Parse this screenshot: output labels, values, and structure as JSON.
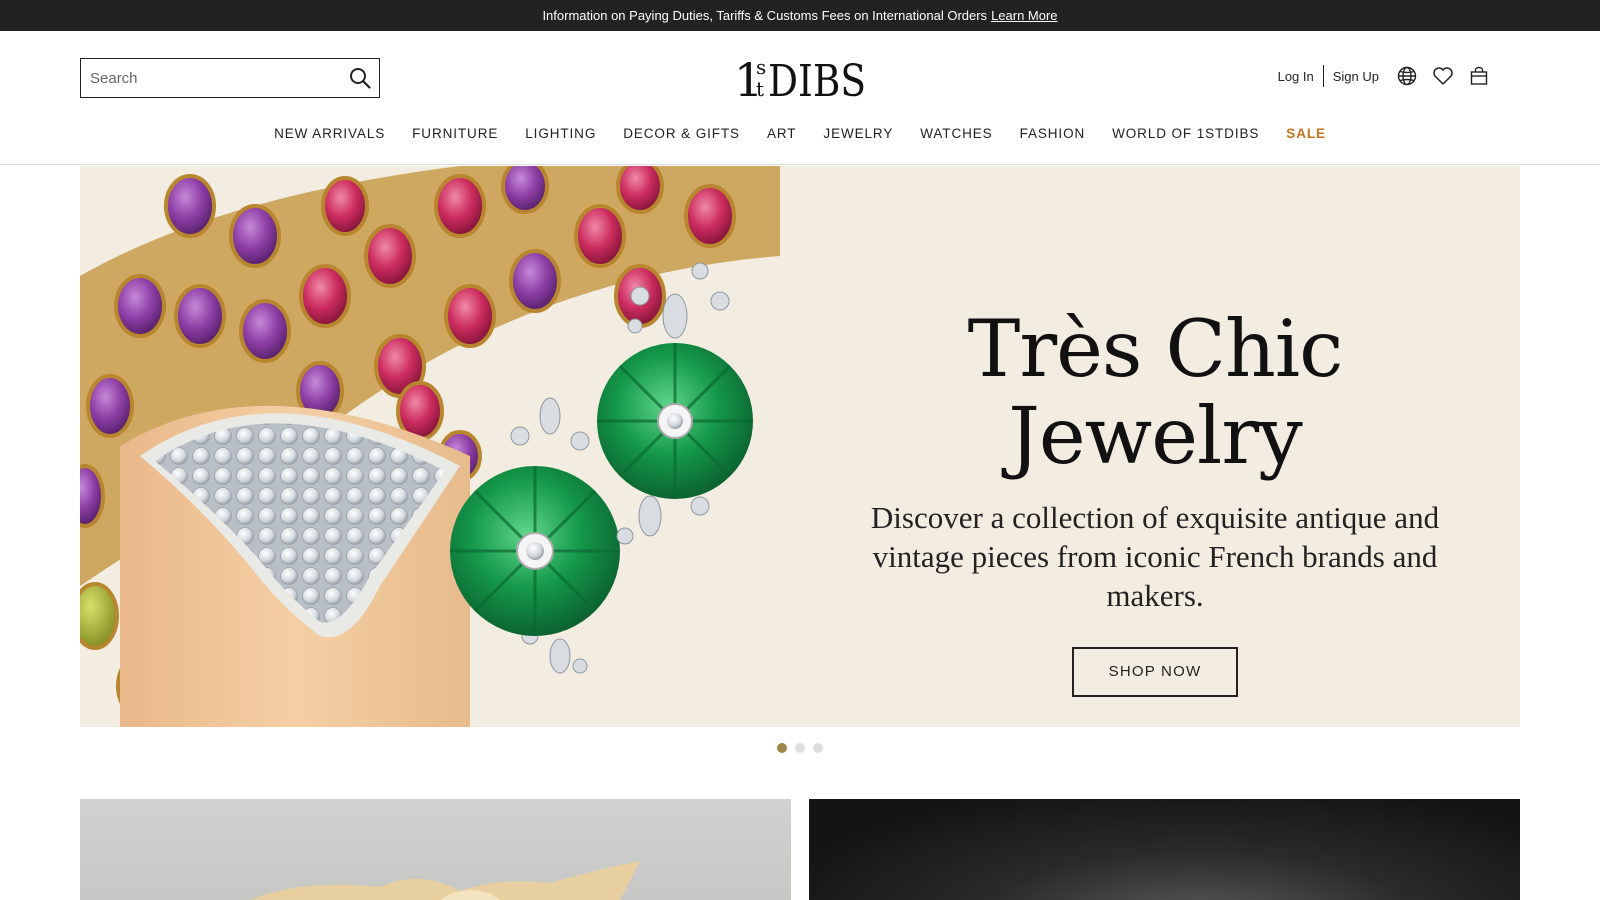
{
  "announcement": {
    "text": "Information on Paying Duties, Tariffs & Customs Fees on International Orders",
    "link": "Learn More"
  },
  "header": {
    "search_placeholder": "Search",
    "logo_text": "1stDIBS",
    "login": "Log In",
    "signup": "Sign Up"
  },
  "nav": {
    "items": [
      "NEW ARRIVALS",
      "FURNITURE",
      "LIGHTING",
      "DECOR & GIFTS",
      "ART",
      "JEWELRY",
      "WATCHES",
      "FASHION",
      "WORLD OF 1STDIBS",
      "SALE"
    ]
  },
  "hero": {
    "title": "Très Chic Jewelry",
    "subtitle": "Discover a collection of exquisite antique and vintage pieces from iconic French brands and makers.",
    "cta": "SHOP NOW"
  },
  "carousel": {
    "slides": 3,
    "active_index": 0
  },
  "colors": {
    "sale": "#c2751f",
    "hero_bg": "#f3ede1",
    "dot_active": "#9e8447",
    "announce_bg": "#222222"
  }
}
